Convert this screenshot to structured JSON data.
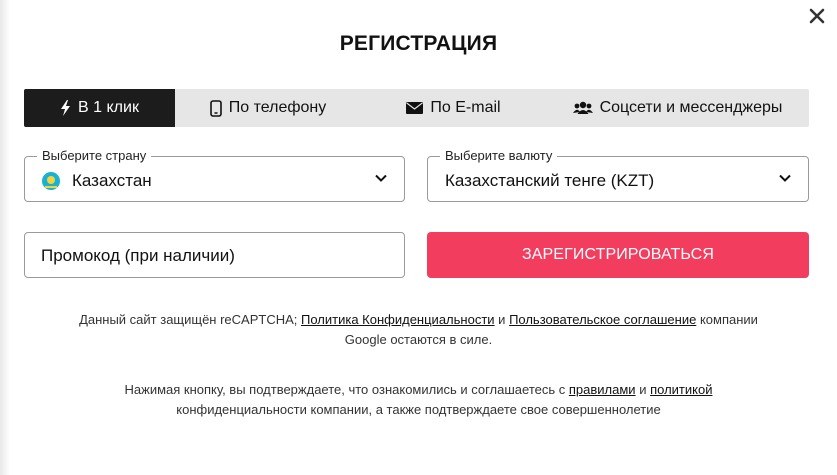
{
  "modal": {
    "title": "РЕГИСТРАЦИЯ"
  },
  "tabs": [
    {
      "label": "В 1 клик",
      "icon": "lightning-icon",
      "active": true
    },
    {
      "label": "По телефону",
      "icon": "phone-icon",
      "active": false
    },
    {
      "label": "По E-mail",
      "icon": "envelope-icon",
      "active": false
    },
    {
      "label": "Соцсети и мессенджеры",
      "icon": "users-icon",
      "active": false
    }
  ],
  "country": {
    "legend": "Выберите страну",
    "value": "Казахстан",
    "flag_icon": "kazakhstan-flag-icon"
  },
  "currency": {
    "legend": "Выберите валюту",
    "value": "Казахстанский тенге (KZT)"
  },
  "promo": {
    "placeholder": "Промокод (при наличии)"
  },
  "register_button": {
    "label": "ЗАРЕГИСТРИРОВАТЬСЯ"
  },
  "recaptcha_note": {
    "part1": "Данный сайт защищён reCAPTCHA;",
    "privacy_link": "Политика Конфиденциальности",
    "and": "и",
    "terms_link": "Пользовательское соглашение",
    "part2": "компании",
    "line2": "Google остаются в силе."
  },
  "consent_note": {
    "part1": "Нажимая кнопку, вы подтверждаете, что ознакомились и соглашаетесь с",
    "rules_link": "правилами",
    "and": "и",
    "policy_link": "политикой",
    "line2": "конфиденциальности компании, а также подтверждаете свое совершеннолетие"
  },
  "colors": {
    "accent": "#f23d5e",
    "active_tab": "#1c1c1c",
    "tab_bg": "#e6e6e6"
  }
}
